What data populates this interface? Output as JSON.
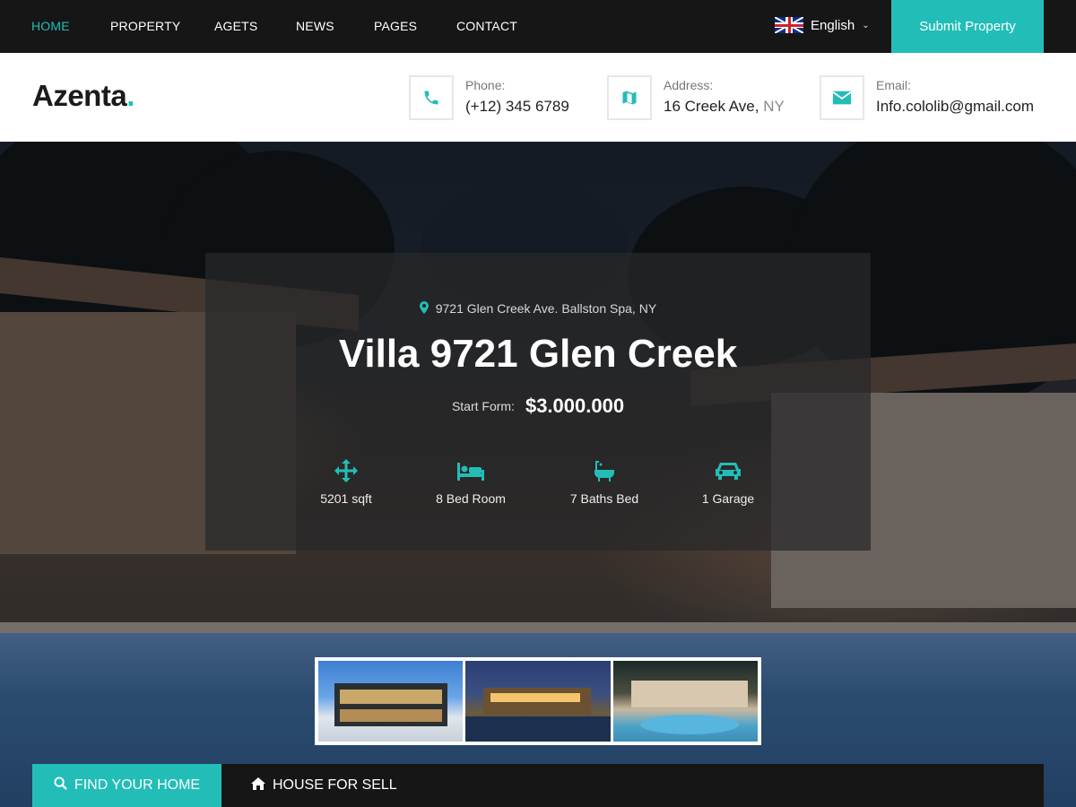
{
  "nav": {
    "items": [
      {
        "label": "HOME",
        "active": true
      },
      {
        "label": "PROPERTY",
        "active": false
      },
      {
        "label": "AGETS",
        "active": false
      },
      {
        "label": "NEWS",
        "active": false
      },
      {
        "label": "PAGES",
        "active": false
      },
      {
        "label": "CONTACT",
        "active": false
      }
    ],
    "language": "English",
    "submit_label": "Submit Property"
  },
  "brand": {
    "name": "Azenta",
    "dot": ".",
    "accent": "#23bdb8"
  },
  "contacts": {
    "phone": {
      "label": "Phone:",
      "value": "(+12) 345 6789",
      "icon": "phone-icon"
    },
    "address": {
      "label": "Address:",
      "value": "16 Creek Ave,",
      "value_muted": "NY",
      "icon": "map-icon"
    },
    "email": {
      "label": "Email:",
      "value": "Info.cololib@gmail.com",
      "icon": "envelope-icon"
    }
  },
  "listing": {
    "address": "9721 Glen Creek Ave. Ballston Spa, NY",
    "title": "Villa 9721 Glen Creek",
    "price_label": "Start Form:",
    "price": "$3.000.000",
    "features": [
      {
        "icon": "arrows-icon",
        "label": "5201 sqft"
      },
      {
        "icon": "bed-icon",
        "label": "8 Bed Room"
      },
      {
        "icon": "bathtub-icon",
        "label": "7 Baths Bed"
      },
      {
        "icon": "car-icon",
        "label": "1 Garage"
      }
    ]
  },
  "search_tabs": {
    "find": "FIND YOUR HOME",
    "sell": "HOUSE FOR SELL"
  }
}
